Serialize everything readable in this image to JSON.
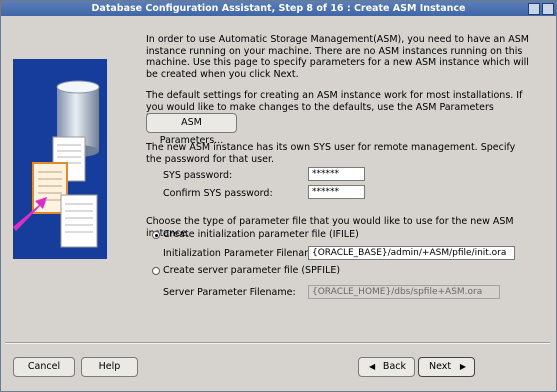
{
  "window": {
    "title": "Database Configuration Assistant, Step 8 of 16 : Create ASM Instance"
  },
  "intro_text": "In order to use Automatic Storage Management(ASM), you need to have an ASM instance running on your machine. There are no ASM instances running on this machine. Use this page to specify parameters for a new ASM instance which will be created when you click Next.",
  "defaults_text": "The default settings for creating an ASM instance work for most installations. If you would like to make changes to the defaults, use the ASM Parameters button.",
  "asm_parameters_button": "ASM Parameters...",
  "sys_text": "The new ASM instance has its own SYS user for remote management. Specify the password for that user.",
  "sys_password": {
    "label": "SYS password:",
    "value": "******"
  },
  "confirm_password": {
    "label": "Confirm SYS password:",
    "value": "******"
  },
  "param_file_text": "Choose the type of parameter file that you would like to use for the new ASM instance.",
  "ifile_option": {
    "label": "Create initialization parameter file (IFILE)",
    "selected": true,
    "field_label": "Initialization Parameter Filename:",
    "field_value": "{ORACLE_BASE}/admin/+ASM/pfile/init.ora"
  },
  "spfile_option": {
    "label": "Create server parameter file (SPFILE)",
    "selected": false,
    "field_label": "Server Parameter Filename:",
    "field_value": "{ORACLE_HOME}/dbs/spfile+ASM.ora"
  },
  "footer": {
    "cancel": "Cancel",
    "help": "Help",
    "back": "Back",
    "next": "Next"
  }
}
